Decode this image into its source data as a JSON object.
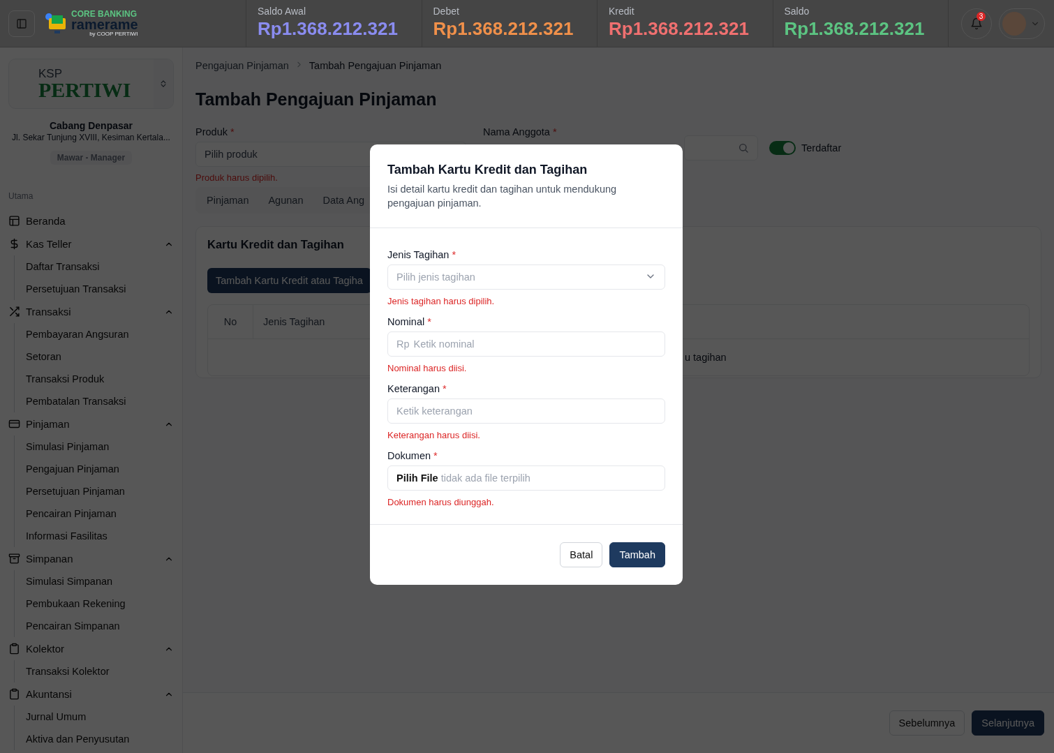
{
  "header": {
    "logo": {
      "line1": "CORE BANKING",
      "line2": "ramerame",
      "line3": "by COOP PERTIWI"
    },
    "stats": [
      {
        "label": "Saldo Awal",
        "value": "Rp1.368.212.321",
        "color": "#8a8cf0"
      },
      {
        "label": "Debet",
        "value": "Rp1.368.212.321",
        "color": "#f0904a"
      },
      {
        "label": "Kredit",
        "value": "Rp1.368.212.321",
        "color": "#f07070"
      },
      {
        "label": "Saldo",
        "value": "Rp1.368.212.321",
        "color": "#5cc482"
      }
    ],
    "notification_count": "3"
  },
  "sidebar": {
    "org": {
      "logo_top": "KSP",
      "logo_main": "PERTIWI",
      "branch": "Cabang Denpasar",
      "address": "Jl. Sekar Tunjung XVIII, Kesiman Kertala...",
      "role": "Mawar - Manager"
    },
    "section": "Utama",
    "items": [
      {
        "label": "Beranda"
      },
      {
        "label": "Kas Teller",
        "expanded": true,
        "children": [
          "Daftar Transaksi",
          "Persetujuan Transaksi"
        ]
      },
      {
        "label": "Transaksi",
        "expanded": true,
        "children": [
          "Pembayaran Angsuran",
          "Setoran",
          "Transaksi Produk",
          "Pembatalan Transaksi"
        ]
      },
      {
        "label": "Pinjaman",
        "expanded": true,
        "children": [
          "Simulasi Pinjaman",
          "Pengajuan Pinjaman",
          "Persetujuan Pinjaman",
          "Pencairan Pinjaman",
          "Informasi Fasilitas"
        ]
      },
      {
        "label": "Simpanan",
        "expanded": true,
        "children": [
          "Simulasi Simpanan",
          "Pembukaan Rekening",
          "Pencairan Simpanan"
        ]
      },
      {
        "label": "Kolektor",
        "expanded": true,
        "children": [
          "Transaksi Kolektor"
        ]
      },
      {
        "label": "Akuntansi",
        "expanded": true,
        "children": [
          "Jurnal Umum",
          "Aktiva dan Penyusutan"
        ]
      }
    ]
  },
  "breadcrumb": [
    "Pengajuan Pinjaman",
    "Tambah Pengajuan Pinjaman"
  ],
  "page_title": "Tambah Pengajuan Pinjaman",
  "form": {
    "produk": {
      "label": "Produk",
      "required_mark": "*",
      "placeholder": "Pilih produk",
      "error": "Produk harus dipilih."
    },
    "anggota": {
      "label": "Nama Anggota",
      "required_mark": "*"
    },
    "registered": {
      "label": "Terdaftar",
      "on": true
    }
  },
  "tabs": [
    {
      "label": "Pinjaman",
      "selected": false
    },
    {
      "label": "Agunan",
      "selected": false
    },
    {
      "label": "Data Ang",
      "selected": false
    }
  ],
  "card": {
    "title": "Kartu Kredit dan Tagihan",
    "add_button": "Tambah Kartu Kredit atau Tagiha",
    "columns": [
      "No",
      "Jenis Tagihan"
    ],
    "empty_text": "u tagihan"
  },
  "footer_buttons": [
    "Sebelumnya",
    "Selanjutnya"
  ],
  "modal": {
    "title": "Tambah Kartu Kredit dan Tagihan",
    "description": "Isi detail kartu kredit dan tagihan untuk mendukung pengajuan pinjaman.",
    "fields": [
      {
        "kind": "select",
        "label": "Jenis Tagihan",
        "required_mark": "*",
        "placeholder": "Pilih jenis tagihan",
        "error": "Jenis tagihan harus dipilih."
      },
      {
        "kind": "currency",
        "label": "Nominal",
        "required_mark": "*",
        "prefix": "Rp",
        "placeholder": "Ketik nominal",
        "error": "Nominal harus diisi."
      },
      {
        "kind": "text",
        "label": "Keterangan",
        "required_mark": "*",
        "placeholder": "Ketik keterangan",
        "error": "Keterangan harus diisi."
      },
      {
        "kind": "file",
        "label": "Dokumen",
        "required_mark": "*",
        "button": "Pilih File",
        "placeholder": "tidak ada file terpilih",
        "error": "Dokumen harus diunggah."
      }
    ],
    "buttons": [
      "Batal",
      "Tambah"
    ]
  }
}
